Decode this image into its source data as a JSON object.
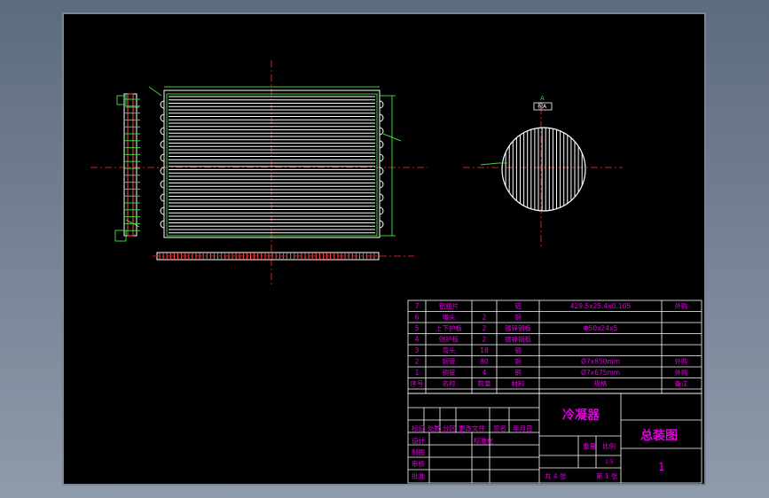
{
  "drawing": {
    "product_name": "冷凝器",
    "drawing_title": "总装图",
    "sheet_no": "1",
    "section_label": "A",
    "section_label2": "视A"
  },
  "bom": {
    "rows": [
      {
        "no": "7",
        "name": "铝翅片",
        "qty": "",
        "material": "铝",
        "spec": "429.5x25.4x0.105",
        "note": "外购"
      },
      {
        "no": "6",
        "name": "堵头",
        "qty": "2",
        "material": "铜",
        "spec": "",
        "note": ""
      },
      {
        "no": "5",
        "name": "上下护板",
        "qty": "2",
        "material": "镀锌钢板",
        "spec": "Φ50x24x5",
        "note": ""
      },
      {
        "no": "4",
        "name": "侧护板",
        "qty": "2",
        "material": "镀锌钢板",
        "spec": "",
        "note": ""
      },
      {
        "no": "3",
        "name": "弯头",
        "qty": "18",
        "material": "铜",
        "spec": "",
        "note": ""
      },
      {
        "no": "2",
        "name": "铜管",
        "qty": "80",
        "material": "铜",
        "spec": "Ø7x850mm",
        "note": "外购"
      },
      {
        "no": "1",
        "name": "铜管",
        "qty": "4",
        "material": "铜",
        "spec": "Ø7x675mm",
        "note": "外购"
      }
    ],
    "header": {
      "no": "序号",
      "name": "名称",
      "qty": "数量",
      "material": "材料",
      "spec": "规格",
      "note": "备注"
    }
  },
  "title_block": {
    "row_labels": [
      "标记",
      "处数",
      "分区",
      "更改文件",
      "签名",
      "年月日"
    ],
    "design": "设计",
    "standard": "标准化",
    "drafting": "制图",
    "check": "审核",
    "approve": "批准",
    "weight": "重量",
    "scale": "比例",
    "scale_value": "1:5",
    "sheets_total": "共 4 张",
    "sheet_label": "第 1 张"
  }
}
